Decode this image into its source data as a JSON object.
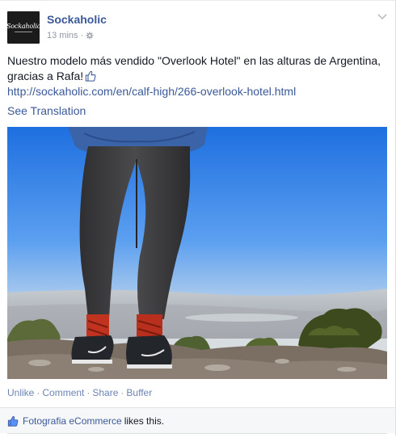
{
  "post": {
    "page_name": "Sockaholic",
    "avatar_logo": "Sockaholic",
    "timestamp": "13 mins",
    "meta_separator": "·",
    "privacy_icon": "globe-icon",
    "menu_icon": "chevron-down-icon",
    "text": "Nuestro modelo más vendido \"Overlook Hotel\" en las alturas de Argentina, gracias a Rafa!",
    "text_emoticon": "thumbs-up-icon",
    "link": "http://sockaholic.com/en/calf-high/266-overlook-hotel.html",
    "see_translation": "See Translation"
  },
  "actions": {
    "unlike": "Unlike",
    "comment": "Comment",
    "share": "Share",
    "buffer": "Buffer",
    "separator": "·"
  },
  "likes": {
    "icon": "thumbs-up-icon",
    "liker": "Fotografia eCommerce",
    "suffix": "likes this."
  },
  "colors": {
    "link_blue": "#3b5998",
    "action_blue": "#6d84b4",
    "meta_gray": "#9197a3",
    "likes_bg": "#f6f7f8"
  }
}
